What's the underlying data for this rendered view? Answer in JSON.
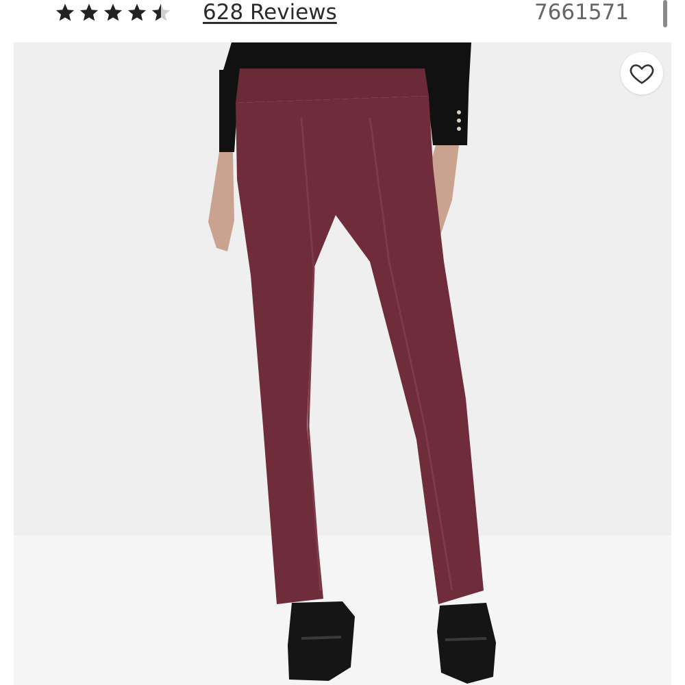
{
  "rating": {
    "value": 4.5,
    "max": 5,
    "reviews_label": "628 Reviews"
  },
  "product": {
    "sku": "7661571",
    "colors": {
      "pants": "#6f2c3a",
      "top": "#111111",
      "shoes": "#151515",
      "background": "#efefef"
    }
  },
  "icons": {
    "star": "star-icon",
    "half_star": "star-half-icon",
    "wishlist": "heart-outline-icon"
  }
}
